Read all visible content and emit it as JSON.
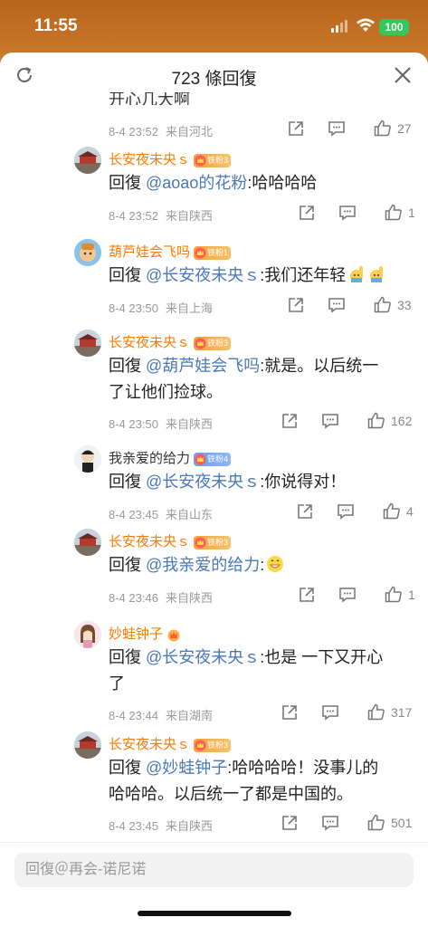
{
  "status": {
    "time": "11:55",
    "battery": "100"
  },
  "header": {
    "title": "723 條回復"
  },
  "top_partial_text": "开心几大啊",
  "top_meta": {
    "date": "8-4 23:52",
    "location": "来自河北",
    "likes": "27"
  },
  "replies": [
    {
      "user": "长安夜未央ｓ",
      "badge": "铁粉3",
      "prefix": "回復 ",
      "mention": "@aoao的花粉",
      "text": ":哈哈哈哈",
      "date": "8-4 23:52",
      "location": "来自陕西",
      "likes": "1"
    },
    {
      "user": "葫芦娃会飞吗",
      "badge": "铁粉1",
      "prefix": "回復 ",
      "mention": "@长安夜未央ｓ",
      "text": ":我们还年轻",
      "date": "8-4 23:50",
      "location": "来自上海",
      "likes": "33"
    },
    {
      "user": "长安夜未央ｓ",
      "badge": "铁粉3",
      "prefix": "回復 ",
      "mention": "@葫芦娃会飞吗",
      "text": ":就是。以后统一",
      "text2": "了让他们捡球。",
      "date": "8-4 23:50",
      "location": "来自陕西",
      "likes": "162"
    },
    {
      "user": "我亲爱的给力",
      "badge": "铁粉4",
      "prefix": "回復 ",
      "mention": "@长安夜未央ｓ",
      "text": ":你说得对！",
      "date": "8-4 23:45",
      "location": "来自山东",
      "likes": "4"
    },
    {
      "user": "长安夜未央ｓ",
      "badge": "铁粉3",
      "prefix": "回復 ",
      "mention": "@我亲爱的给力",
      "text": ":",
      "date": "8-4 23:46",
      "location": "来自陕西",
      "likes": "1"
    },
    {
      "user": "妙蛙钟子",
      "badge": "",
      "prefix": "回復 ",
      "mention": "@长安夜未央ｓ",
      "text": ":也是 一下又开心",
      "text2": "了",
      "date": "8-4 23:44",
      "location": "来自湖南",
      "likes": "317"
    },
    {
      "user": "长安夜未央ｓ",
      "badge": "铁粉3",
      "prefix": "回復 ",
      "mention": "@妙蛙钟子",
      "text": ":哈哈哈哈！没事儿的",
      "text2": "哈哈哈。以后统一了都是中国的。",
      "date": "8-4 23:45",
      "location": "来自陕西",
      "likes": "501"
    }
  ],
  "input": {
    "placeholder": "回復＠再会-诺尼诺"
  },
  "colors": {
    "accent": "#ff7a00",
    "mention": "#4a78b8",
    "meta": "#999999"
  }
}
